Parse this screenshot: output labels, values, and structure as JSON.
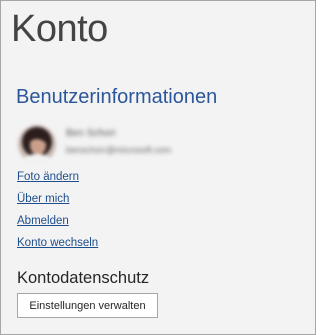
{
  "page": {
    "title": "Konto"
  },
  "user_info": {
    "heading": "Benutzerinformationen",
    "name": "Ben Schorr",
    "email": "benschorr@microsoft.com"
  },
  "links": [
    {
      "label": "Foto ändern"
    },
    {
      "label": "Über mich"
    },
    {
      "label": "Abmelden"
    },
    {
      "label": "Konto wechseln"
    }
  ],
  "privacy": {
    "heading": "Kontodatenschutz",
    "button_label": "Einstellungen verwalten"
  },
  "colors": {
    "accent": "#2b579a",
    "link": "#1f4e8c",
    "background": "#f3f3f3",
    "border": "#a6a6a6"
  }
}
